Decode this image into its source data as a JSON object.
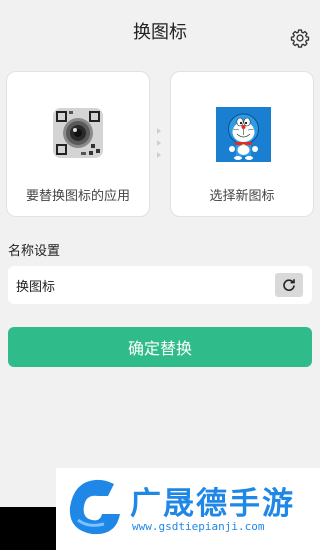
{
  "header": {
    "title": "换图标",
    "settings_icon": "gear-icon"
  },
  "cards": {
    "source_label": "要替换图标的应用",
    "target_label": "选择新图标",
    "source_icon": "camera-lens-icon",
    "target_icon": "doraemon-icon"
  },
  "name_section": {
    "label": "名称设置",
    "value": "换图标",
    "reset_icon": "refresh-icon"
  },
  "actions": {
    "confirm_label": "确定替换"
  },
  "watermark": {
    "title": "广晟德手游",
    "url": "www.gsdtiepianji.com"
  },
  "colors": {
    "accent": "#2fbc8a",
    "background": "#f1f1f1",
    "watermark_blue": "#1f88e6"
  }
}
